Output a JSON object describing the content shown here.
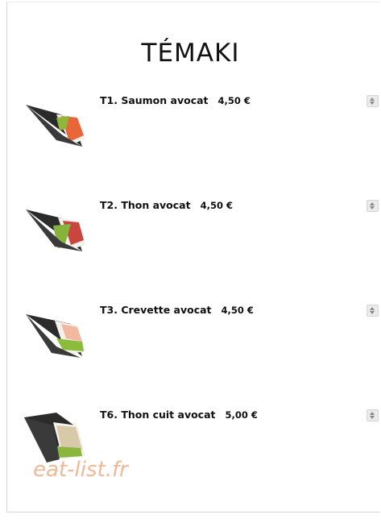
{
  "page": {
    "title": "TÉMAKI"
  },
  "items": [
    {
      "code_name": "T1. Saumon avocat",
      "price": "4,50 €",
      "filling": "#e8663a",
      "filling2": "#8fb83a"
    },
    {
      "code_name": "T2. Thon avocat",
      "price": "4,50 €",
      "filling": "#c9463f",
      "filling2": "#86b33b"
    },
    {
      "code_name": "T3. Crevette avocat",
      "price": "4,50 €",
      "filling": "#f2b9a0",
      "filling2": "#8cbc3c"
    },
    {
      "code_name": "T6. Thon cuit avocat",
      "price": "5,00 €",
      "filling": "#d8c9a8",
      "filling2": "#8ab63e"
    }
  ],
  "watermark": "eat-list.fr",
  "colors": {
    "seaweed": "#2b2b2b",
    "rice": "#f4f1ea",
    "watermark": "#f0b895"
  }
}
